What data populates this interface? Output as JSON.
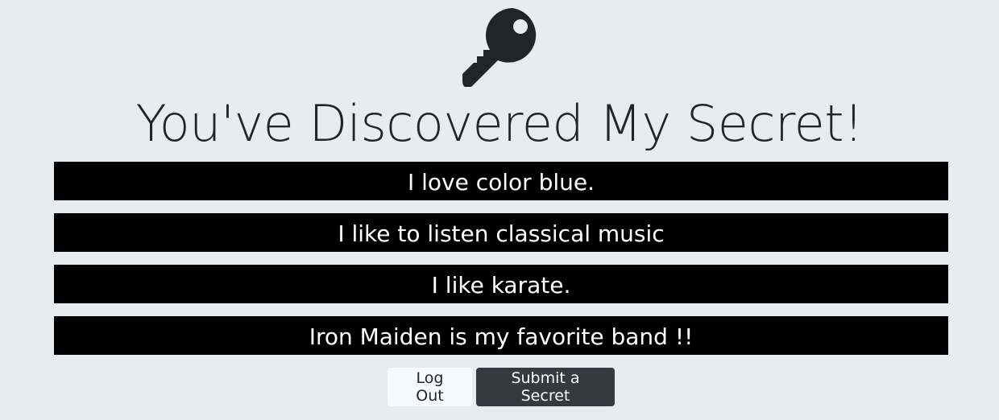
{
  "header": {
    "icon": "key-icon",
    "title": "You've Discovered My Secret!"
  },
  "secrets": [
    "I love color blue.",
    "I like to listen classical music",
    "I like karate.",
    "Iron Maiden is my favorite band !!"
  ],
  "actions": {
    "logout_label": "Log Out",
    "submit_label": "Submit a Secret"
  },
  "colors": {
    "background": "#e9ecef",
    "secret_bar": "#000000",
    "secret_text": "#ffffff",
    "logout_button": "#f8f9fa",
    "submit_button": "#343a40",
    "icon": "#212529"
  }
}
